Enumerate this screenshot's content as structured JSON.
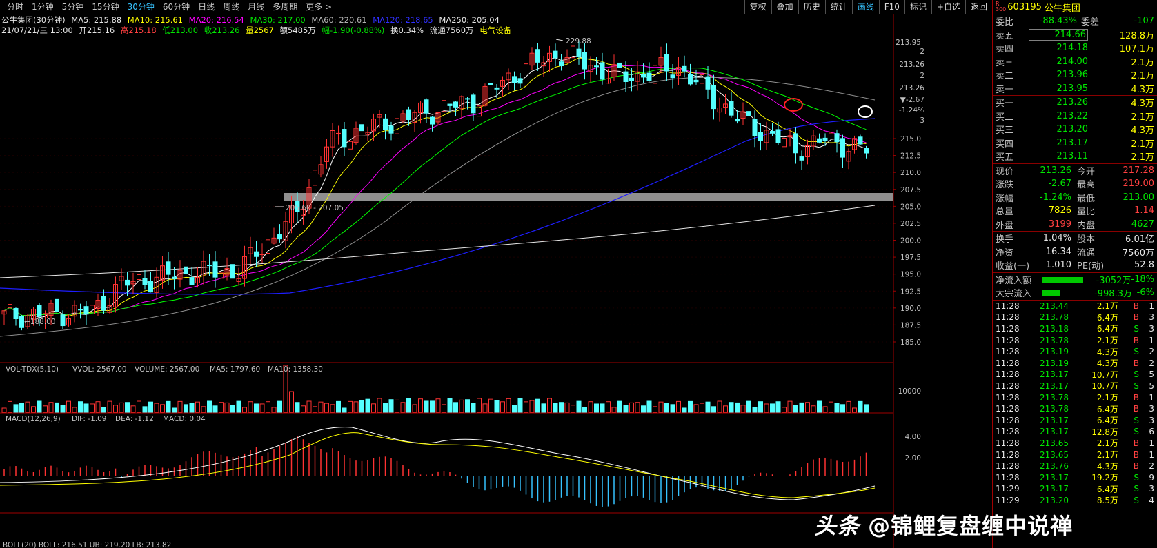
{
  "toolbar": {
    "periods": [
      "分时",
      "1分钟",
      "5分钟",
      "15分钟",
      "30分钟",
      "60分钟",
      "日线",
      "周线",
      "月线",
      "多周期",
      "更多 >"
    ],
    "active_period": "30分钟",
    "tools": [
      "复权",
      "叠加",
      "历史",
      "统计",
      "画线",
      "F10",
      "标记",
      "+自选",
      "返回"
    ],
    "active_tool": "画线"
  },
  "info": {
    "name": "公牛集团(30分钟)",
    "ma5": "MA5: 215.88",
    "ma10": "MA10: 215.61",
    "ma20": "MA20: 216.54",
    "ma30": "MA30: 217.00",
    "ma60": "MA60: 220.61",
    "ma120": "MA120: 218.65",
    "ma250": "MA250: 205.04",
    "date": "21/07/21/三 13:00",
    "open": "开215.16",
    "high": "高215.18",
    "low": "低213.00",
    "close": "收213.26",
    "vol": "量2567",
    "amount": "额5485万",
    "change": "幅-1.90(-0.88%)",
    "turnover": "换0.34%",
    "float": "流通7560万",
    "sector": "电气设备"
  },
  "main_chart": {
    "price_ticks": [
      "215.0",
      "212.5",
      "210.0",
      "207.5",
      "205.0",
      "202.5",
      "200.0",
      "197.5",
      "195.0",
      "192.5",
      "190.0",
      "187.5",
      "185.0"
    ],
    "top_label": "213.95",
    "right_annots": [
      "2",
      "213.26",
      "2",
      "213.26",
      "▼-2.67",
      "-1.24%",
      "3"
    ],
    "high_label": "229.88",
    "low_label": "←188.00",
    "gap_label": "205.60 - 207.05"
  },
  "vol_panel": {
    "title": "VOL-TDX(5,10)",
    "vvol": "VVOL: 2567.00",
    "volume": "VOLUME: 2567.00",
    "ma5": "MA5: 1797.60",
    "ma10": "MA10: 1358.30",
    "tick": "10000"
  },
  "macd_panel": {
    "title": "MACD(12,26,9)",
    "dif": "DIF: -1.09",
    "dea": "DEA: -1.12",
    "macd": "MACD: 0.04",
    "ticks": [
      "4.00",
      "2.00"
    ]
  },
  "bottom_label": "BOLL(20) BOLL: 216.51 UB: 219.20 LB: 213.82",
  "quote": {
    "code": "603195",
    "name": "公牛集团",
    "weibi_label": "委比",
    "weibi": "-88.43%",
    "weicha_label": "委差",
    "weicha": "-107",
    "asks": [
      {
        "label": "卖五",
        "price": "214.66",
        "vol": "128.8万"
      },
      {
        "label": "卖四",
        "price": "214.18",
        "vol": "107.1万"
      },
      {
        "label": "卖三",
        "price": "214.00",
        "vol": "2.1万"
      },
      {
        "label": "卖二",
        "price": "213.96",
        "vol": "2.1万"
      },
      {
        "label": "卖一",
        "price": "213.95",
        "vol": "4.3万"
      }
    ],
    "bids": [
      {
        "label": "买一",
        "price": "213.26",
        "vol": "4.3万"
      },
      {
        "label": "买二",
        "price": "213.22",
        "vol": "2.1万"
      },
      {
        "label": "买三",
        "price": "213.20",
        "vol": "4.3万"
      },
      {
        "label": "买四",
        "price": "213.17",
        "vol": "2.1万"
      },
      {
        "label": "买五",
        "price": "213.11",
        "vol": "2.1万"
      }
    ],
    "stats": [
      {
        "l1": "现价",
        "v1": "213.26",
        "l2": "今开",
        "v2": "217.28",
        "c1": "green",
        "c2": "red"
      },
      {
        "l1": "涨跌",
        "v1": "-2.67",
        "l2": "最高",
        "v2": "219.00",
        "c1": "green",
        "c2": "red"
      },
      {
        "l1": "涨幅",
        "v1": "-1.24%",
        "l2": "最低",
        "v2": "213.00",
        "c1": "green",
        "c2": "green"
      },
      {
        "l1": "总量",
        "v1": "7826",
        "l2": "量比",
        "v2": "1.14",
        "c1": "yel",
        "c2": "red"
      },
      {
        "l1": "外盘",
        "v1": "3199",
        "l2": "内盘",
        "v2": "4627",
        "c1": "red",
        "c2": "green"
      }
    ],
    "stats2": [
      {
        "l1": "换手",
        "v1": "1.04%",
        "l2": "股本",
        "v2": "6.01亿"
      },
      {
        "l1": "净资",
        "v1": "16.34",
        "l2": "流通",
        "v2": "7560万"
      },
      {
        "l1": "收益(一)",
        "v1": "1.010",
        "l2": "PE(动)",
        "v2": "52.8"
      }
    ],
    "flows": [
      {
        "label": "净流入额",
        "val": "-3052万",
        "pct": "-18%",
        "bar": 0.45
      },
      {
        "label": "大宗流入",
        "val": "-998.3万",
        "pct": "-6%",
        "bar": 0.2
      }
    ],
    "ticks": [
      {
        "t": "11:28",
        "p": "213.44",
        "v": "2.1万",
        "s": "B",
        "n": "1"
      },
      {
        "t": "11:28",
        "p": "213.78",
        "v": "6.4万",
        "s": "B",
        "n": "3"
      },
      {
        "t": "11:28",
        "p": "213.18",
        "v": "6.4万",
        "s": "S",
        "n": "3"
      },
      {
        "t": "11:28",
        "p": "213.78",
        "v": "2.1万",
        "s": "B",
        "n": "1"
      },
      {
        "t": "11:28",
        "p": "213.19",
        "v": "4.3万",
        "s": "S",
        "n": "2"
      },
      {
        "t": "11:28",
        "p": "213.19",
        "v": "4.3万",
        "s": "B",
        "n": "2"
      },
      {
        "t": "11:28",
        "p": "213.17",
        "v": "10.7万",
        "s": "S",
        "n": "5"
      },
      {
        "t": "11:28",
        "p": "213.17",
        "v": "10.7万",
        "s": "S",
        "n": "5"
      },
      {
        "t": "11:28",
        "p": "213.78",
        "v": "2.1万",
        "s": "B",
        "n": "1"
      },
      {
        "t": "11:28",
        "p": "213.78",
        "v": "6.4万",
        "s": "B",
        "n": "3"
      },
      {
        "t": "11:28",
        "p": "213.17",
        "v": "6.4万",
        "s": "S",
        "n": "3"
      },
      {
        "t": "11:28",
        "p": "213.17",
        "v": "12.8万",
        "s": "S",
        "n": "6"
      },
      {
        "t": "11:28",
        "p": "213.65",
        "v": "2.1万",
        "s": "B",
        "n": "1"
      },
      {
        "t": "11:28",
        "p": "213.65",
        "v": "2.1万",
        "s": "B",
        "n": "1"
      },
      {
        "t": "11:28",
        "p": "213.76",
        "v": "4.3万",
        "s": "B",
        "n": "2"
      },
      {
        "t": "11:28",
        "p": "213.17",
        "v": "19.2万",
        "s": "S",
        "n": "9"
      },
      {
        "t": "11:29",
        "p": "213.17",
        "v": "6.4万",
        "s": "S",
        "n": "3"
      },
      {
        "t": "11:29",
        "p": "213.20",
        "v": "8.5万",
        "s": "S",
        "n": "4"
      }
    ]
  },
  "watermark": {
    "logo": "头条",
    "text": "@锦鲤复盘缠中说禅"
  },
  "colors": {
    "up": "#ff3232",
    "down": "#54ffff",
    "ma5": "#ffffff",
    "ma10": "#ffff00",
    "ma20": "#ff00ff",
    "ma30": "#00ff00",
    "ma60": "#808080",
    "ma120": "#0000ff",
    "ma250": "#ffffff"
  }
}
